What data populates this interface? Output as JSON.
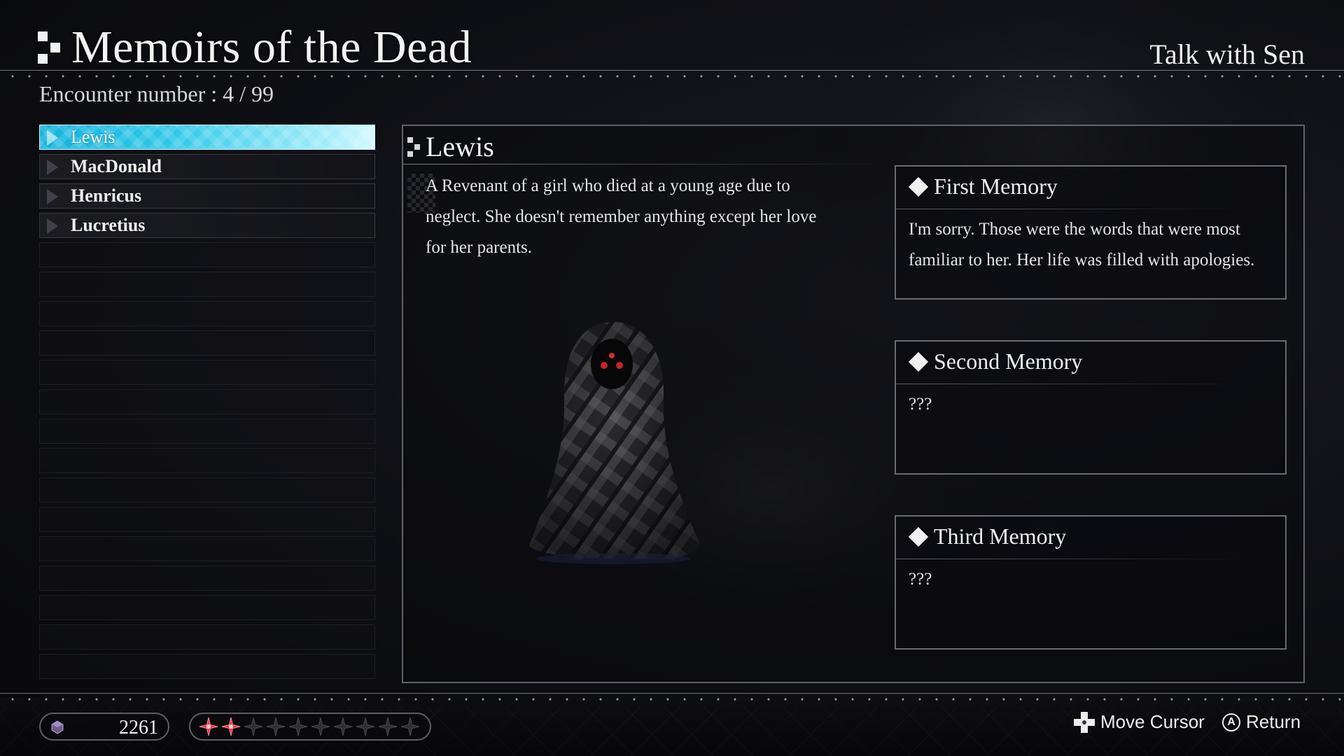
{
  "header": {
    "title": "Memoirs of the Dead",
    "talk_label": "Talk with Sen",
    "encounter": "Encounter number : 4 / 99"
  },
  "list": {
    "items": [
      {
        "label": "Lewis",
        "selected": true
      },
      {
        "label": "MacDonald",
        "selected": false
      },
      {
        "label": "Henricus",
        "selected": false
      },
      {
        "label": "Lucretius",
        "selected": false
      }
    ],
    "empty_rows": 15,
    "selected_color": "#2fc8ea"
  },
  "detail": {
    "name": "Lewis",
    "description": "A Revenant of a girl who died at a young age due to neglect. She doesn't remember anything except her love for her parents.",
    "memories": [
      {
        "title": "First Memory",
        "text": "I'm sorry. Those were the words that were most familiar to her. Her life was filled with apologies."
      },
      {
        "title": "Second Memory",
        "text": "???"
      },
      {
        "title": "Third Memory",
        "text": "???"
      }
    ]
  },
  "footer": {
    "currency_value": "2261",
    "currency_icon": "gem-icon",
    "pips_filled": 2,
    "pips_total": 10,
    "pip_color": "#e8324a",
    "hint_move": "Move Cursor",
    "hint_return": "Return",
    "button_a": "A"
  }
}
